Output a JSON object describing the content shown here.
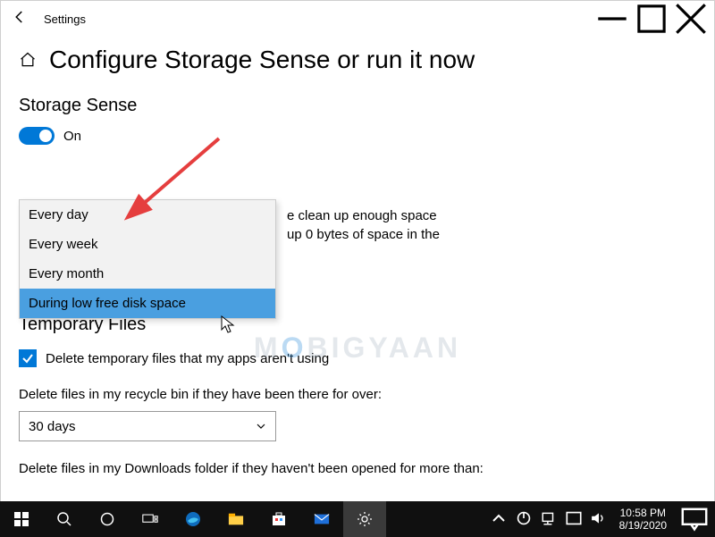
{
  "titlebar": {
    "app_name": "Settings"
  },
  "page": {
    "title": "Configure Storage Sense or run it now",
    "storage_sense_heading": "Storage Sense",
    "toggle_state": "On",
    "hidden_text_line1": "e clean up enough space",
    "hidden_text_line2": "up 0 bytes of space in the",
    "temp_files_heading": "Temporary Files",
    "checkbox_label": "Delete temporary files that my apps aren't using",
    "recycle_label": "Delete files in my recycle bin if they have been there for over:",
    "recycle_value": "30 days",
    "downloads_label": "Delete files in my Downloads folder if they haven't been opened for more than:"
  },
  "dropdown": {
    "items": [
      "Every day",
      "Every week",
      "Every month",
      "During low free disk space"
    ]
  },
  "watermark": {
    "prefix": "M",
    "o": "O",
    "suffix": "BIGYAAN"
  },
  "taskbar": {
    "time": "10:58 PM",
    "date": "8/19/2020"
  }
}
